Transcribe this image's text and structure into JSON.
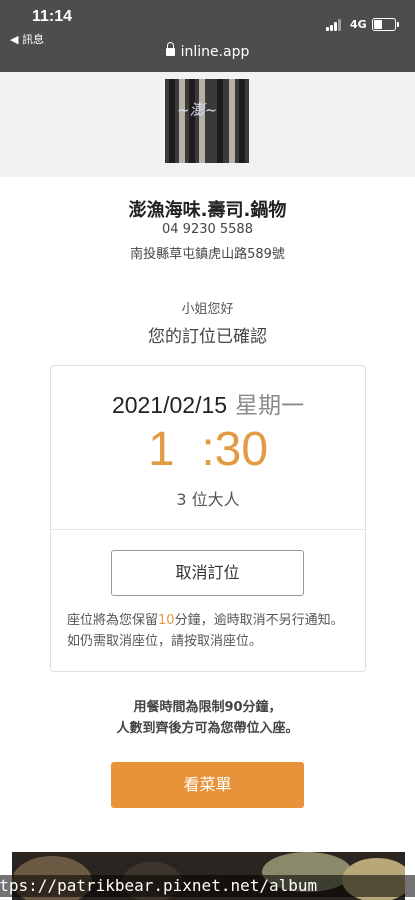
{
  "status_bar": {
    "time": "11:14",
    "back_label": "◀ 訊息",
    "network": "4G"
  },
  "browser": {
    "url": "inline.app"
  },
  "restaurant": {
    "name": "澎漁海味.壽司.鍋物",
    "phone": "04 9230 5588",
    "address": "南投縣草屯鎮虎山路589號"
  },
  "confirmation": {
    "greeting": "小姐您好",
    "title": "您的訂位已確認"
  },
  "booking": {
    "date": "2021/02/15",
    "weekday": "星期一",
    "time": "1  :30",
    "guests": "3 位大人",
    "cancel_label": "取消訂位",
    "note_prefix": "座位將為您保留",
    "note_minutes": "10",
    "note_suffix": "分鐘，逾時取消不另行通知。如仍需取消座位，請按取消座位。"
  },
  "dining_info": {
    "line1": "用餐時間為限制90分鐘，",
    "line2": "人數到齊後方可為您帶位入座。"
  },
  "menu_button": {
    "label": "看菜單"
  },
  "watermark": {
    "text": "https://patrikbear.pixnet.net/album"
  },
  "colors": {
    "accent": "#e8933a",
    "status_bar": "#4d4d4d"
  }
}
